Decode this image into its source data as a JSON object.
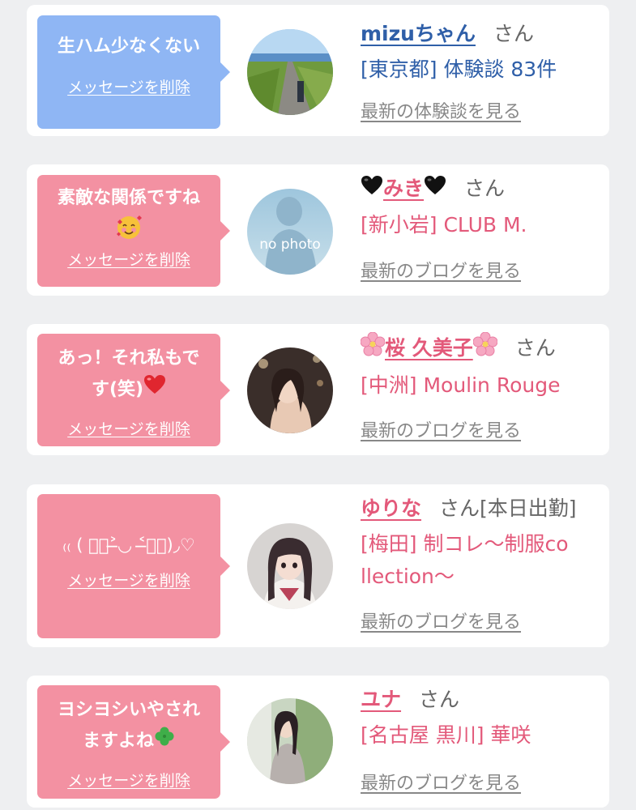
{
  "common": {
    "delete_label": "メッセージを削除",
    "honorific": "さん"
  },
  "items": [
    {
      "message": "生ハム少なくない",
      "name": "mizuちゃん",
      "badge": "",
      "detail": "[東京都] 体験談 83件",
      "more_link": "最新の体験談を見る",
      "theme": "blue",
      "avatar": "road-photo"
    },
    {
      "message": "素敵な関係ですね",
      "message_emoji": "smiling-face-with-hearts",
      "name": "みき",
      "name_prefix_emoji": "black-heart",
      "name_suffix_emoji": "black-heart",
      "badge": "",
      "detail": "[新小岩] CLUB M.",
      "more_link": "最新のブログを見る",
      "theme": "pink",
      "avatar": "no photo"
    },
    {
      "message": "あっ！それ私もです(笑)",
      "message_emoji": "red-heart",
      "name": "桜 久美子",
      "name_prefix_emoji": "cherry-blossom",
      "name_suffix_emoji": "cherry-blossom",
      "badge": "",
      "detail": "[中洲] Moulin Rouge",
      "more_link": "最新のブログを見る",
      "theme": "pink",
      "avatar": "portrait-woman"
    },
    {
      "message": "₍₍ ( ๑॔˃̶◡ ˂̶๑॓)◞♡",
      "name": "ゆりな",
      "badge": "[本日出勤]",
      "detail": "[梅田] 制コレ〜制服collection〜",
      "more_link": "最新のブログを見る",
      "theme": "pink",
      "avatar": "portrait-woman"
    },
    {
      "message": "ヨシヨシいやされますよね",
      "message_emoji": "four-leaf-clover",
      "name": "ユナ",
      "badge": "",
      "detail": "[名古屋 黒川] 華咲",
      "more_link": "最新のブログを見る",
      "theme": "pink",
      "avatar": "portrait-woman"
    }
  ]
}
